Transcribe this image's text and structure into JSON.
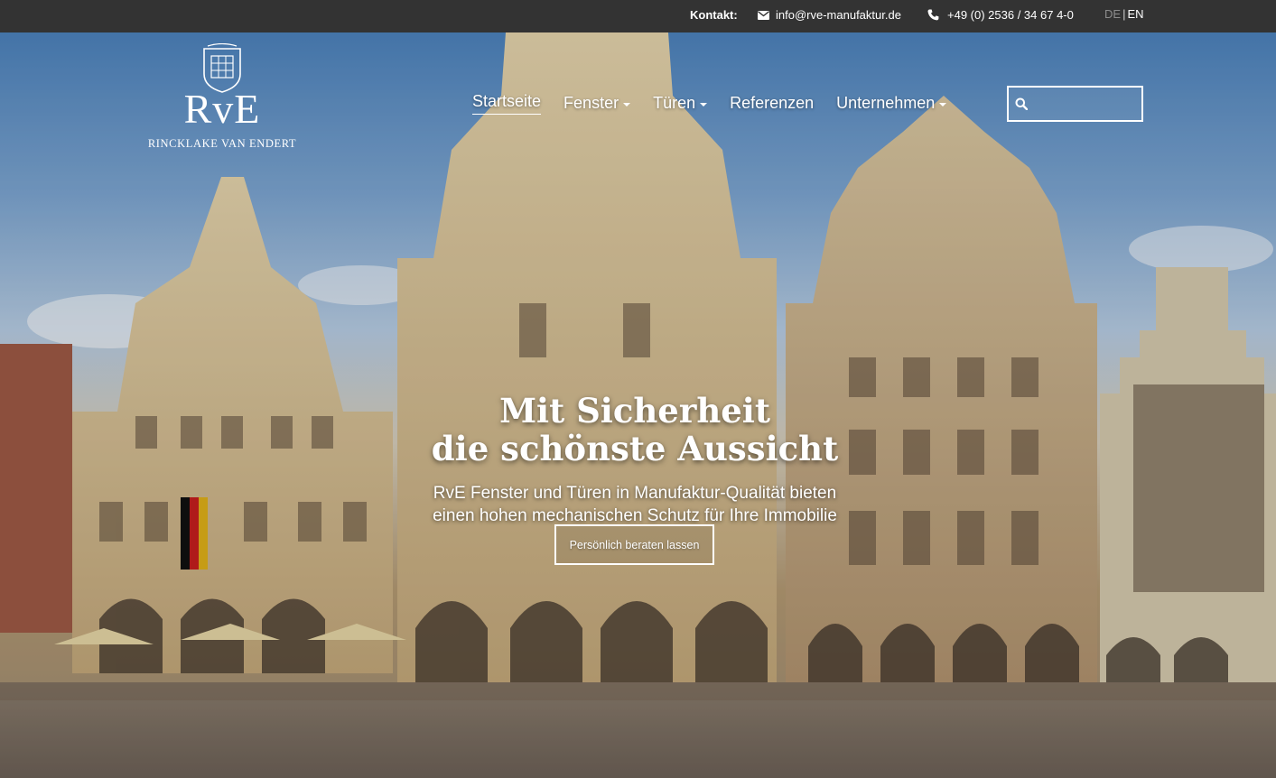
{
  "topbar": {
    "contact_label": "Kontakt:",
    "email": "info@rve-manufaktur.de",
    "phone": "+49 (0) 2536 / 34 67 4-0",
    "lang_de": "DE",
    "lang_separator": "|",
    "lang_en": "EN"
  },
  "logo": {
    "mark": "RvE",
    "subtitle": "RINCKLAKE VAN ENDERT"
  },
  "nav": {
    "items": [
      {
        "label": "Startseite",
        "active": true,
        "dropdown": false
      },
      {
        "label": "Fenster",
        "active": false,
        "dropdown": true
      },
      {
        "label": "Türen",
        "active": false,
        "dropdown": true
      },
      {
        "label": "Referenzen",
        "active": false,
        "dropdown": false
      },
      {
        "label": "Unternehmen",
        "active": false,
        "dropdown": true
      }
    ]
  },
  "search": {
    "value": "",
    "icon": "search-icon"
  },
  "hero": {
    "headline_line1": "Mit Sicherheit",
    "headline_line2": "die schönste Aussicht",
    "subline_line1": "RvE Fenster und Türen in Manufaktur-Qualität bieten",
    "subline_line2": "einen hohen mechanischen Schutz für Ihre Immobilie",
    "cta_label": "Persönlich beraten lassen"
  },
  "colors": {
    "topbar_bg": "#333333",
    "text": "#ffffff",
    "lang_inactive": "#8c8c8c"
  }
}
